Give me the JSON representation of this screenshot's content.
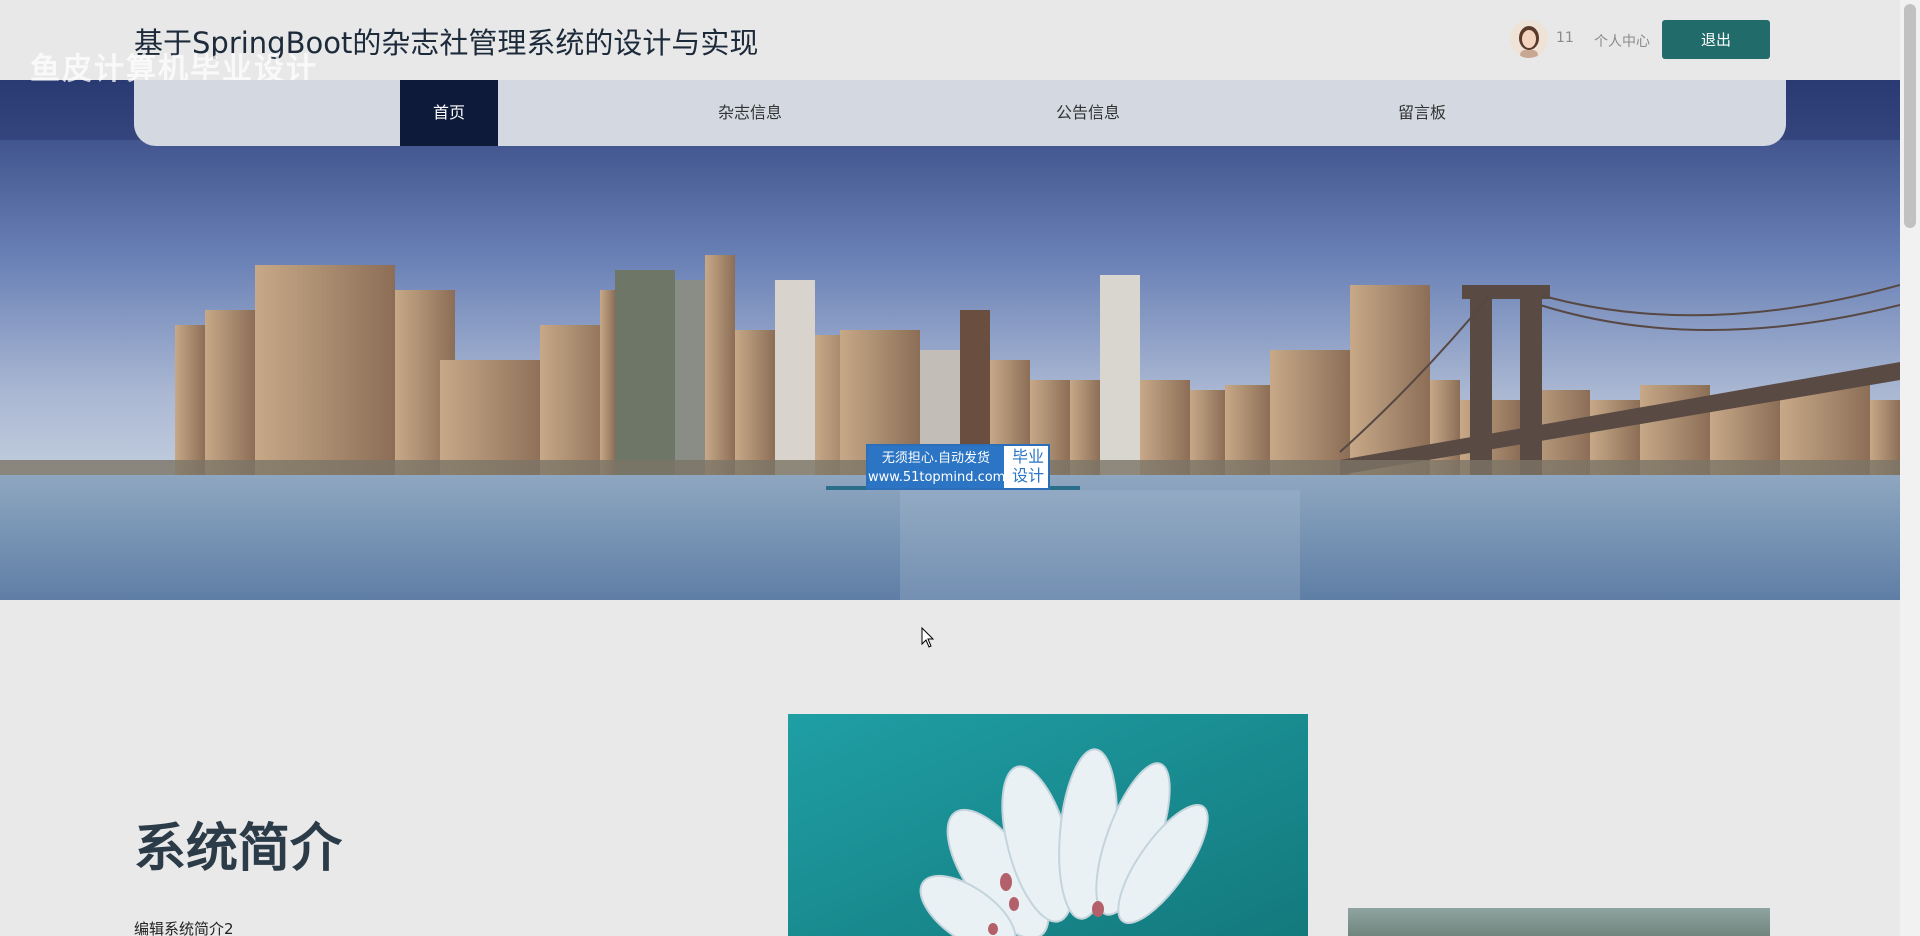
{
  "header": {
    "title": "基于SpringBoot的杂志社管理系统的设计与实现",
    "watermark": "鱼皮计算机毕业设计",
    "username": "11",
    "profile_label": "个人中心",
    "logout_label": "退出"
  },
  "nav": {
    "items": [
      {
        "label": "首页",
        "active": true
      },
      {
        "label": "杂志信息",
        "active": false
      },
      {
        "label": "公告信息",
        "active": false
      },
      {
        "label": "留言板",
        "active": false
      }
    ]
  },
  "banner_badge": {
    "line1": "无须担心.自动发货",
    "line2": "www.51topmind.com",
    "right1": "毕业",
    "right2": "设计"
  },
  "intro": {
    "title": "系统简介",
    "text": "编辑系统简介2"
  },
  "colors": {
    "accent": "#216c6a",
    "nav_active": "#0e1a3a",
    "nav_bg": "#d4d9e1"
  }
}
